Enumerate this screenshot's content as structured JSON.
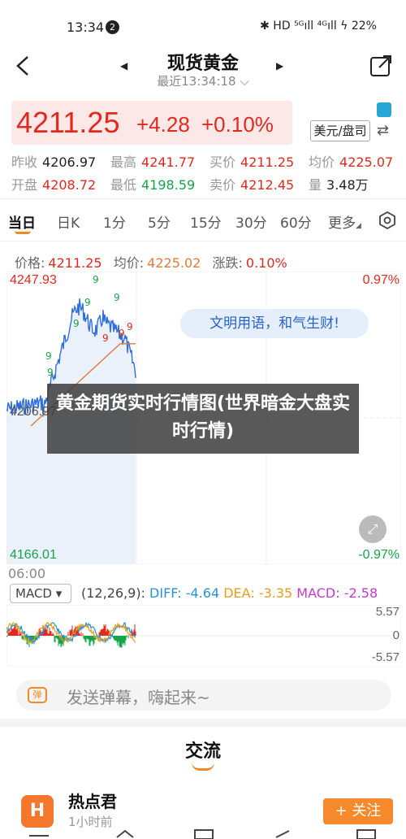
{
  "status": {
    "time": "13:34",
    "badge": "2",
    "icons": "✱ HD ⁵ᴳıll ⁴ᴳıll ϟ 22%"
  },
  "nav": {
    "title": "现货黄金",
    "subtitle": "最近13:34:18 ⌵"
  },
  "price": {
    "current": "4211.25",
    "change": "+4.28",
    "change_pct": "+0.10%",
    "unit": "美元/盘司",
    "swap": "⇄"
  },
  "stats": {
    "row1": [
      {
        "label": "昨收",
        "value": "4206.97",
        "color": "dark"
      },
      {
        "label": "最高",
        "value": "4241.77",
        "color": "red"
      },
      {
        "label": "买价",
        "value": "4211.25",
        "color": "red"
      },
      {
        "label": "均价",
        "value": "4225.07",
        "color": "red"
      }
    ],
    "row2": [
      {
        "label": "开盘",
        "value": "4208.72",
        "color": "red"
      },
      {
        "label": "最低",
        "value": "4198.59",
        "color": "green"
      },
      {
        "label": "卖价",
        "value": "4212.45",
        "color": "red"
      },
      {
        "label": "量",
        "value": "3.48万",
        "color": "dark"
      }
    ]
  },
  "tabs": [
    "当日",
    "日K",
    "1分",
    "5分",
    "15分",
    "30分",
    "60分",
    "更多"
  ],
  "info": {
    "price_label": "价格:",
    "price_value": "4211.25",
    "avg_label": "均价:",
    "avg_value": "4225.02",
    "chg_label": "涨跌:",
    "chg_value": "0.10%"
  },
  "chart": {
    "y_top": "4247.93",
    "y_bottom": "4166.01",
    "pct_top": "0.97%",
    "pct_bottom": "-0.97%",
    "mid_label": "4206.97",
    "time_start": "06:00",
    "signal": "9",
    "colors": {
      "up": "#e0291f",
      "down": "#17a34a",
      "line": "#2f6fe0",
      "avg": "#e07a3a"
    }
  },
  "banner": "文明用语，和气生财!",
  "overlay": "黄金期货实时行情图(世界暗金大盘实时行情)",
  "macd": {
    "button": "MACD ▾",
    "params": "(12,26,9):",
    "diff": "DIFF: -4.64",
    "dea": "DEA: -3.35",
    "macd": "MACD: -2.58",
    "top": "5.57",
    "zero": "0",
    "bottom": "-5.57"
  },
  "danmu": {
    "icon": "弹",
    "placeholder": "发送弹幕，嗨起来~"
  },
  "section": {
    "title": "交流"
  },
  "user": {
    "avatar": "H",
    "name": "热点君",
    "time": "1小时前",
    "follow": "+ 关注"
  }
}
